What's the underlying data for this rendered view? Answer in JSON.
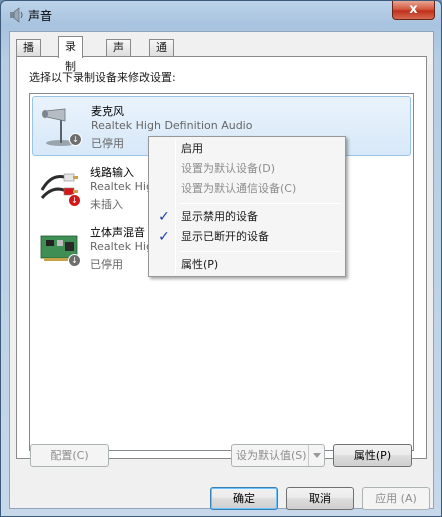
{
  "window": {
    "title": "声音",
    "close_label": "x"
  },
  "tabs": [
    {
      "label": "播放"
    },
    {
      "label": "录制"
    },
    {
      "label": "声音"
    },
    {
      "label": "通信"
    }
  ],
  "panel": {
    "instruction": "选择以下录制设备来修改设置:"
  },
  "devices": [
    {
      "name": "麦克风",
      "description": "Realtek High Definition Audio",
      "status": "已停用",
      "icon": "microphone-icon",
      "badge": "down-arrow-badge"
    },
    {
      "name": "线路输入",
      "description": "Realtek Hig",
      "status": "未插入",
      "icon": "line-in-cable-icon",
      "badge": "red-down-arrow-badge"
    },
    {
      "name": "立体声混音",
      "description": "Realtek Hig",
      "status": "已停用",
      "icon": "sound-card-icon",
      "badge": "down-arrow-badge"
    }
  ],
  "context_menu": {
    "items": [
      {
        "label": "启用",
        "enabled": true,
        "checked": false
      },
      {
        "label": "设置为默认设备(D)",
        "enabled": false,
        "checked": false
      },
      {
        "label": "设置为默认通信设备(C)",
        "enabled": false,
        "checked": false
      },
      {
        "label": "显示禁用的设备",
        "enabled": true,
        "checked": true
      },
      {
        "label": "显示已断开的设备",
        "enabled": true,
        "checked": true
      },
      {
        "label": "属性(P)",
        "enabled": true,
        "checked": false
      }
    ]
  },
  "buttons": {
    "configure": "配置(C)",
    "set_default": "设为默认值(S)",
    "properties": "属性(P)",
    "ok": "确定",
    "cancel": "取消",
    "apply": "应用 (A)"
  },
  "colors": {
    "selection_border": "#99c4ec",
    "close_button": "#c1301b",
    "check_mark": "#1a3fb0",
    "badge_gray": "#6e6e6e",
    "badge_red": "#d21818"
  }
}
